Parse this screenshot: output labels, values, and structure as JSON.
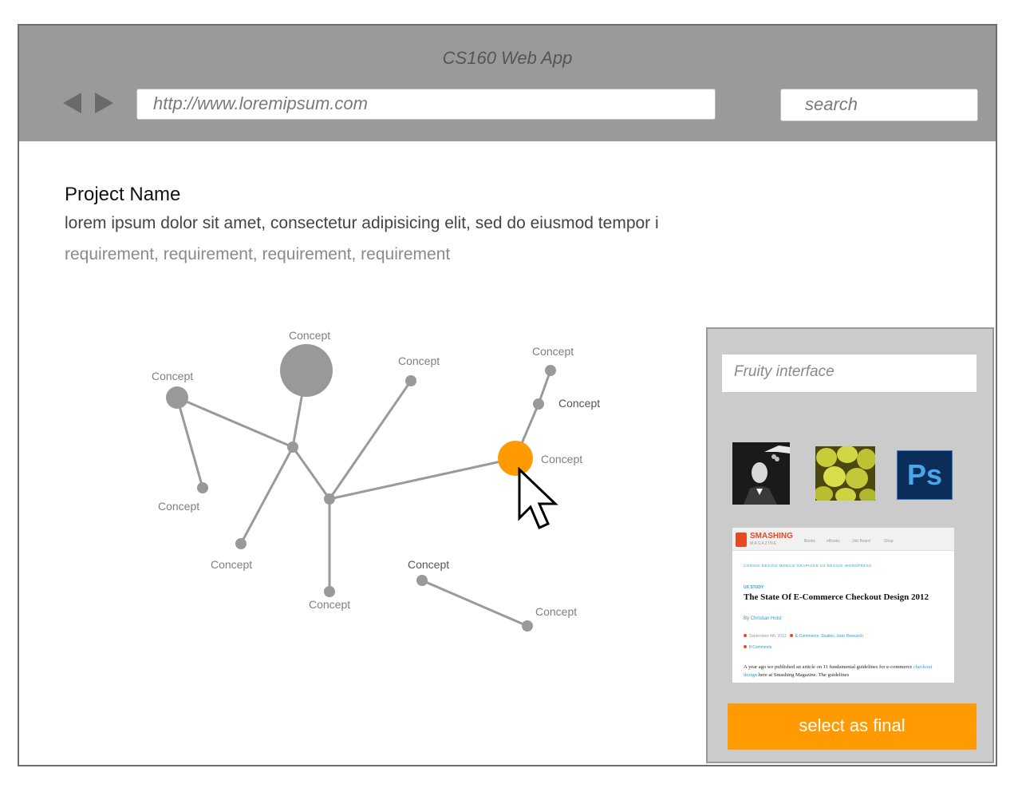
{
  "browser": {
    "title": "CS160 Web App",
    "url": "http://www.loremipsum.com",
    "search_placeholder": "search"
  },
  "project": {
    "name": "Project Name",
    "description": "lorem ipsum dolor sit amet, consectetur adipisicing elit, sed do eiusmod tempor i",
    "requirements": "requirement, requirement, requirement, requirement"
  },
  "concept_map": {
    "node_label": "Concept",
    "labels": [
      "Concept",
      "Concept",
      "Concept",
      "Concept",
      "Concept",
      "Concept",
      "Concept",
      "Concept",
      "Concept",
      "Concept",
      "Concept",
      "Concept"
    ],
    "active_color": "#ff9a00",
    "node_color": "#999999"
  },
  "side_panel": {
    "search_value": "Fruity interface",
    "images": [
      "portrait-photo",
      "pears-photo",
      "photoshop-logo"
    ],
    "ps_label": "Ps",
    "article": {
      "logo": "SMASHING",
      "logo_sub": "MAGAZINE",
      "nav": [
        "Books",
        "eBooks",
        "Job Board",
        "Shop"
      ],
      "categories": "CODING   DESIGN   MOBILE   GRAPHICS   UX DESIGN   WORDPRESS",
      "kicker": "UX STUDY",
      "title": "The State Of E-Commerce Checkout Design 2012",
      "by": "By",
      "author": "Christian Holst",
      "date": "September 4th, 2012",
      "tags": "E-Commerce, Studies, User Research",
      "comments": "8 Comments",
      "body_1": "A year ago we published an article on 11 fundamental guidelines for e-commerce",
      "body_link": "checkout design",
      "body_2": "here at Smashing Magazine. The guidelines"
    },
    "final_button": "select as final"
  }
}
